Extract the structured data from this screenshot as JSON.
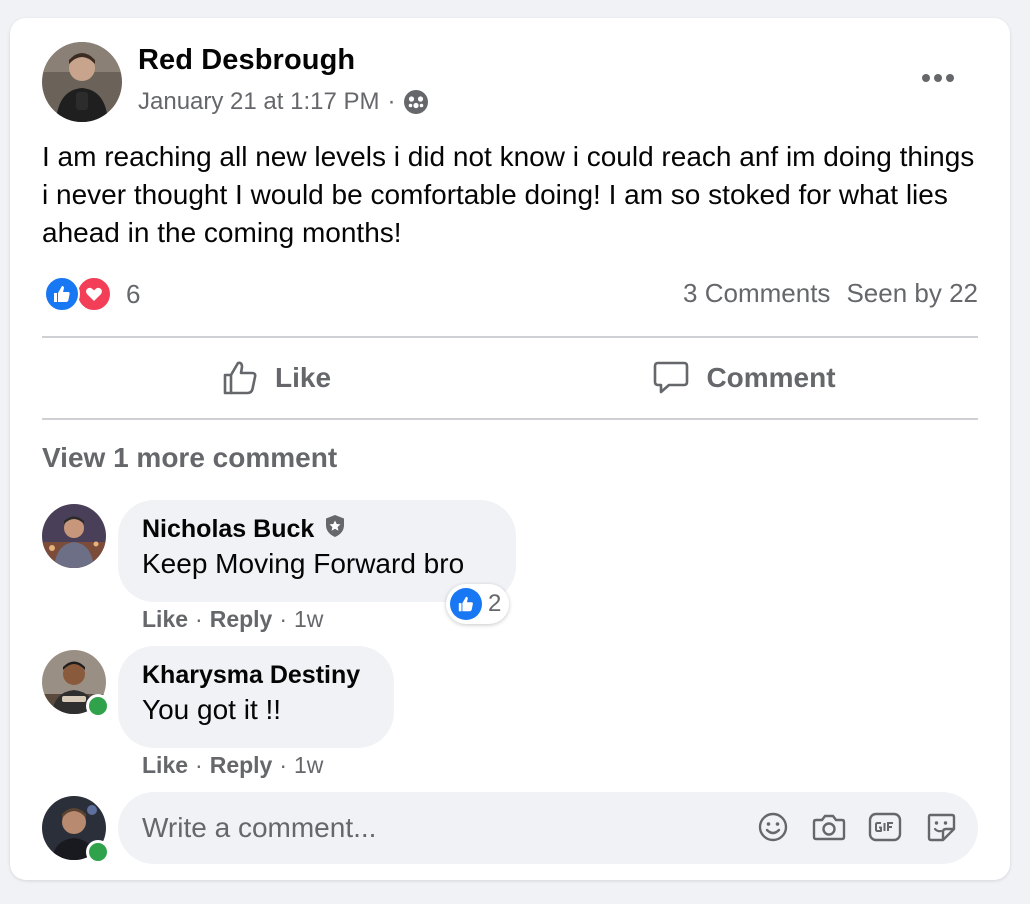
{
  "post": {
    "author": "Red Desbrough",
    "timestamp": "January 21 at 1:17 PM",
    "separator": "·",
    "audience_icon": "group-audience-icon",
    "text": "I am reaching all new levels i did not know i could reach anf im doing things i never thought I would be comfortable doing! I am so stoked for what lies ahead in the coming months!",
    "reaction_count": "6",
    "comments_label": "3 Comments",
    "seen_by_label": "Seen by 22"
  },
  "actions": {
    "like_label": "Like",
    "comment_label": "Comment"
  },
  "comments_section": {
    "view_more_label": "View 1 more comment",
    "comments": [
      {
        "name": "Nicholas Buck",
        "badge_icon": "shield-badge-icon",
        "text": "Keep Moving Forward bro",
        "like_label": "Like",
        "reply_label": "Reply",
        "age": "1w",
        "reaction_count": "2"
      },
      {
        "name": "Kharysma Destiny",
        "text": "You got it !!",
        "like_label": "Like",
        "reply_label": "Reply",
        "age": "1w",
        "online": true
      }
    ]
  },
  "composer": {
    "placeholder": "Write a comment...",
    "icons": [
      "emoji-icon",
      "camera-icon",
      "gif-icon",
      "sticker-icon"
    ]
  },
  "colors": {
    "primary_text": "#050505",
    "secondary_text": "#65676b",
    "like_blue": "#1877f2",
    "love_red": "#f33e58",
    "online_green": "#31a24c",
    "bubble_bg": "#f0f2f5"
  }
}
